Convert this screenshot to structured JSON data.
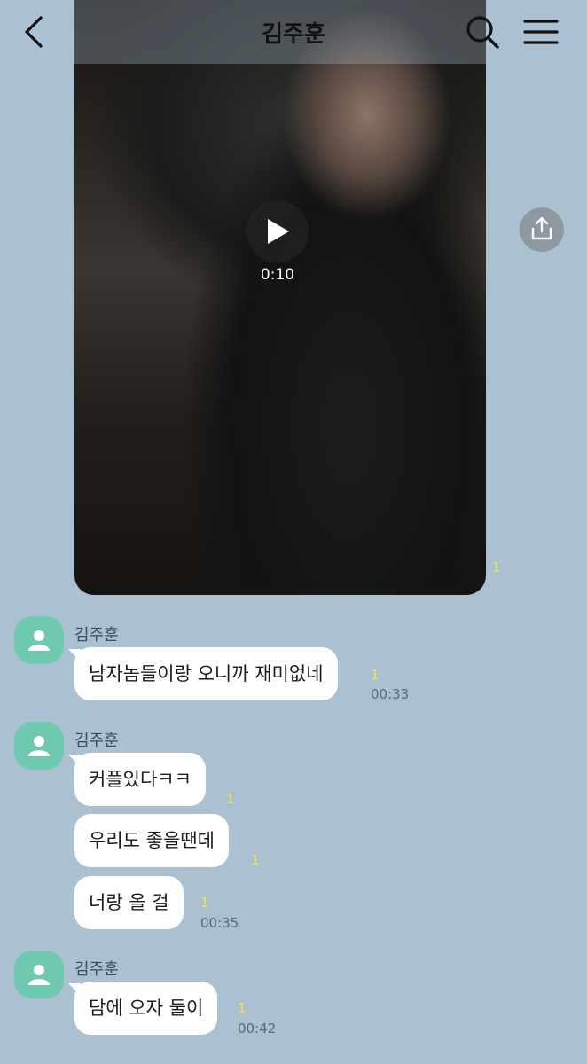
{
  "header": {
    "title": "김주훈",
    "back_icon": "chevron-left-icon",
    "search_icon": "search-icon",
    "menu_icon": "hamburger-menu-icon"
  },
  "video": {
    "duration": "0:10",
    "read_count": "1"
  },
  "share_icon": "share-upload-icon",
  "groups": [
    {
      "sender": "김주훈",
      "messages": [
        {
          "text": "남자놈들이랑 오니까 재미없네",
          "read": "1",
          "time": "00:33"
        }
      ]
    },
    {
      "sender": "김주훈",
      "messages": [
        {
          "text": "커플있다ㅋㅋ",
          "read": "1"
        },
        {
          "text": "우리도 좋을땐데",
          "read": "1"
        },
        {
          "text": "너랑 올 걸",
          "read": "1",
          "time": "00:35"
        }
      ]
    },
    {
      "sender": "김주훈",
      "messages": [
        {
          "text": "담에 오자 둘이",
          "read": "1",
          "time": "00:42"
        }
      ]
    }
  ],
  "colors": {
    "background": "#abc1d1",
    "avatar": "#6fc9b1",
    "read_marker": "#f6e24a",
    "bubble": "#ffffff"
  }
}
